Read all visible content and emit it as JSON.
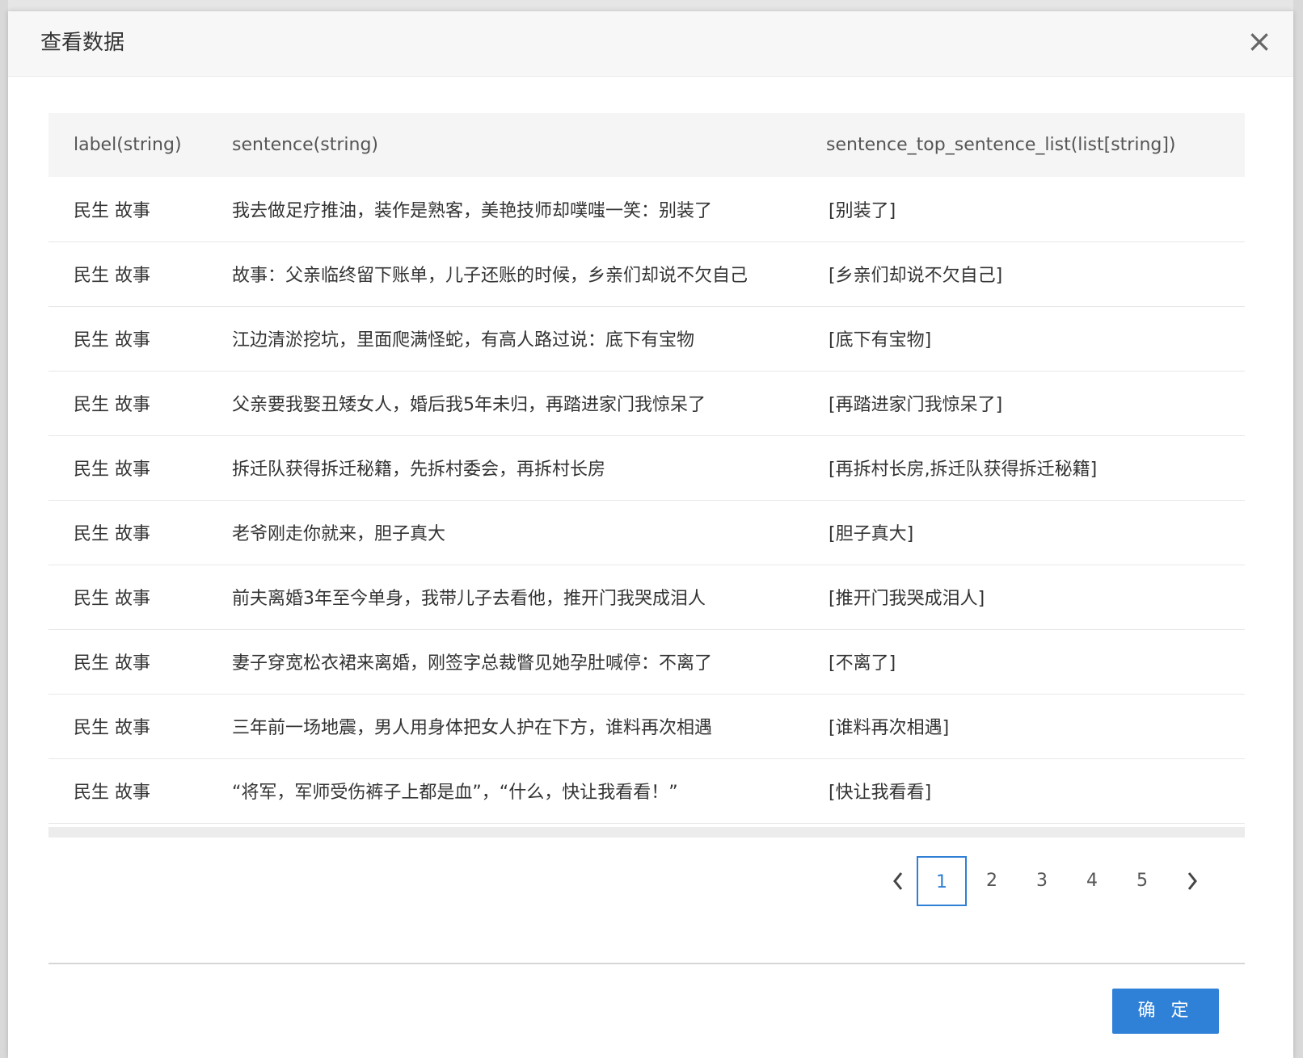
{
  "modal": {
    "title": "查看数据",
    "close_glyph": "×",
    "ok_label": "确 定"
  },
  "table": {
    "columns": [
      "label(string)",
      "sentence(string)",
      "sentence_top_sentence_list(list[string])"
    ],
    "rows": [
      [
        "民生 故事",
        "我去做足疗推油，装作是熟客，美艳技师却噗嗤一笑：别装了",
        "[别装了]"
      ],
      [
        "民生 故事",
        "故事：父亲临终留下账单，儿子还账的时候，乡亲们却说不欠自己",
        "[乡亲们却说不欠自己]"
      ],
      [
        "民生 故事",
        "江边清淤挖坑，里面爬满怪蛇，有高人路过说：底下有宝物",
        "[底下有宝物]"
      ],
      [
        "民生 故事",
        "父亲要我娶丑矮女人，婚后我5年未归，再踏进家门我惊呆了",
        "[再踏进家门我惊呆了]"
      ],
      [
        "民生 故事",
        "拆迁队获得拆迁秘籍，先拆村委会，再拆村长房",
        "[再拆村长房,拆迁队获得拆迁秘籍]"
      ],
      [
        "民生 故事",
        "老爷刚走你就来，胆子真大",
        "[胆子真大]"
      ],
      [
        "民生 故事",
        "前夫离婚3年至今单身，我带儿子去看他，推开门我哭成泪人",
        "[推开门我哭成泪人]"
      ],
      [
        "民生 故事",
        "妻子穿宽松衣裙来离婚，刚签字总裁瞥见她孕肚喊停：不离了",
        "[不离了]"
      ],
      [
        "民生 故事",
        "三年前一场地震，男人用身体把女人护在下方，谁料再次相遇",
        "[谁料再次相遇]"
      ],
      [
        "民生 故事",
        "“将军，军师受伤裤子上都是血”，“什么，快让我看看！”",
        "[快让我看看]"
      ]
    ]
  },
  "pagination": {
    "pages": [
      "1",
      "2",
      "3",
      "4",
      "5"
    ],
    "current": "1",
    "prev_icon": "chevron-left-icon",
    "next_icon": "chevron-right-icon",
    "accent": "#2f7fd6"
  },
  "colors": {
    "header_bg": "#f7f7f7",
    "table_header_bg": "#f5f5f5",
    "primary_button": "#2f80d7"
  }
}
